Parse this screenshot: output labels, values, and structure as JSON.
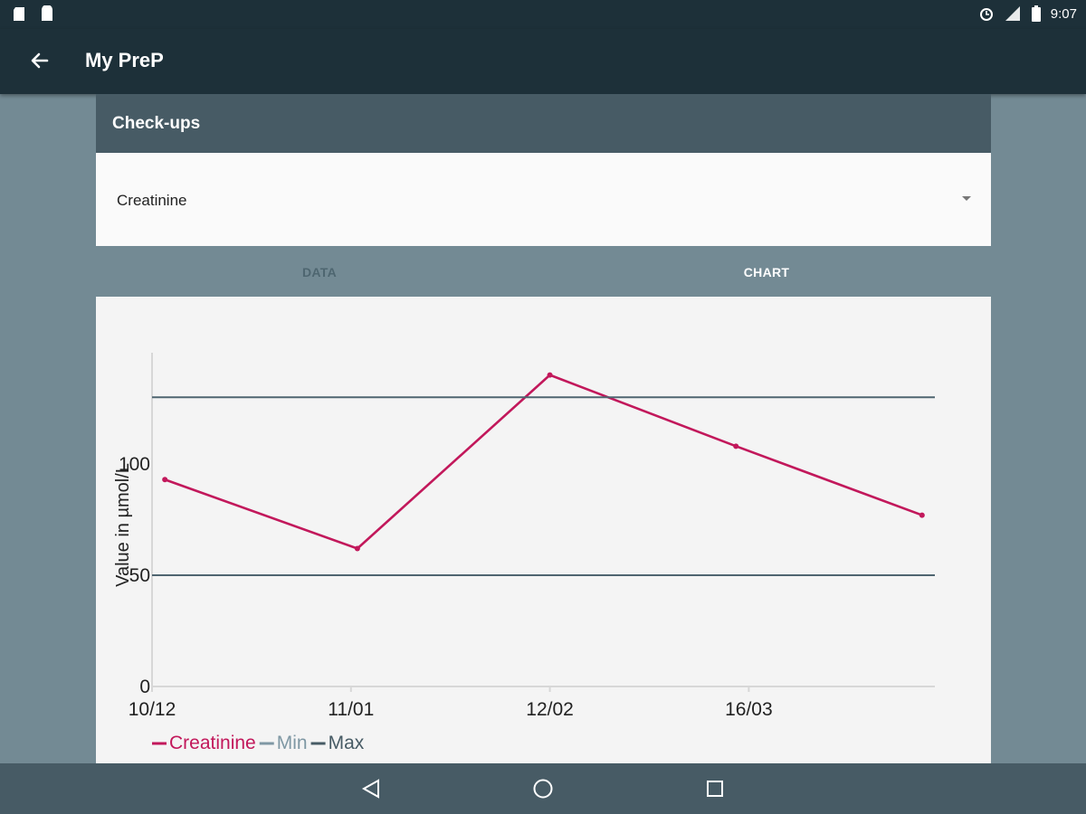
{
  "status_bar": {
    "time": "9:07",
    "icons": [
      "notification-icon",
      "notification-icon",
      "alarm-icon",
      "signal-icon",
      "battery-icon"
    ]
  },
  "app_bar": {
    "title": "My PreP"
  },
  "panel": {
    "title": "Check-ups"
  },
  "spinner": {
    "selected": "Creatinine"
  },
  "tabs": [
    {
      "label": "DATA",
      "active": false
    },
    {
      "label": "CHART",
      "active": true
    }
  ],
  "chart_data": {
    "type": "line",
    "ylabel": "Value in µmol/L",
    "y_ticks": [
      "0",
      "50",
      "100"
    ],
    "ylim": [
      0,
      150
    ],
    "x_ticks": [
      "10/12",
      "11/01",
      "12/02",
      "16/03"
    ],
    "series": [
      {
        "name": "Creatinine",
        "color": "#c2185b",
        "points": [
          [
            2,
            93
          ],
          [
            32,
            62
          ],
          [
            62,
            140
          ],
          [
            91,
            108
          ],
          [
            120,
            77
          ]
        ]
      },
      {
        "name": "Min",
        "color": "#7f98a4",
        "constant": 50
      },
      {
        "name": "Max",
        "color": "#475b65",
        "constant": 130
      }
    ],
    "x_tick_positions": [
      0,
      31,
      62,
      93
    ],
    "xlim": [
      0,
      122
    ],
    "grid": false,
    "legend": "bottom-left"
  },
  "colors": {
    "primary_dark": "#1d3039",
    "header": "#475b65",
    "background": "#738a94",
    "accent": "#c2185b"
  }
}
